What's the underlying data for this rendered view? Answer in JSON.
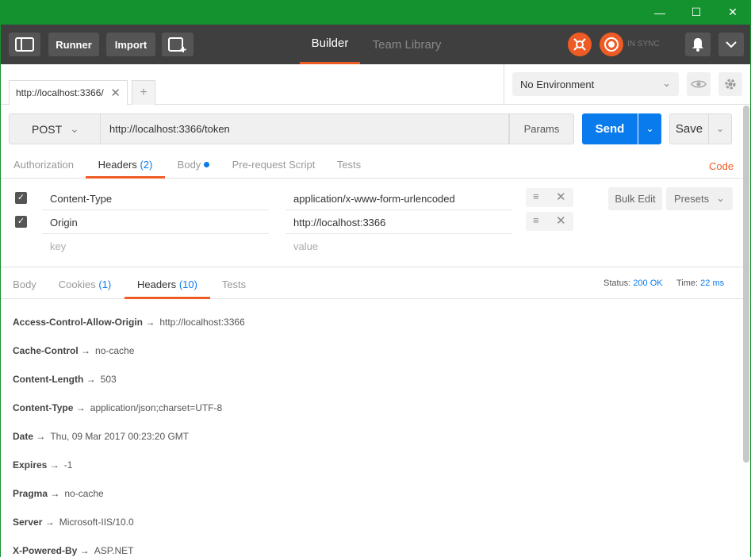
{
  "window": {
    "minimize_glyph": "—",
    "maximize_glyph": "☐",
    "close_glyph": "✕"
  },
  "header": {
    "sidebar_icon": "sidebar-toggle-icon",
    "runner_label": "Runner",
    "import_label": "Import",
    "new_window_icon": "new-window-icon",
    "tabs": [
      {
        "label": "Builder",
        "active": true
      },
      {
        "label": "Team Library",
        "active": false
      }
    ],
    "sync_status": "IN SYNC",
    "accent": "#ef5b25"
  },
  "request_tab": {
    "title": "http://localhost:3366/",
    "close_glyph": "✕",
    "add_glyph": "+"
  },
  "environment": {
    "selected": "No Environment",
    "chevron": "⌄"
  },
  "url_bar": {
    "method": "POST",
    "chevron": "⌄",
    "url": "http://localhost:3366/token",
    "params_label": "Params",
    "send_label": "Send",
    "send_dd_glyph": "⌄",
    "save_label": "Save",
    "save_dd_glyph": "⌄",
    "send_color": "#097bed"
  },
  "request_tabs": {
    "authorization": "Authorization",
    "headers": "Headers",
    "headers_count": "(2)",
    "body": "Body",
    "prerequest": "Pre-request Script",
    "tests": "Tests",
    "code": "Code"
  },
  "headers_editor": {
    "rows": [
      {
        "key": "Content-Type",
        "value": "application/x-www-form-urlencoded",
        "checked": true
      },
      {
        "key": "Origin",
        "value": "http://localhost:3366",
        "checked": true
      }
    ],
    "key_placeholder": "key",
    "value_placeholder": "value",
    "check_glyph": "✓",
    "menu_glyph": "≡",
    "delete_glyph": "✕",
    "bulk_edit_label": "Bulk Edit",
    "presets_label": "Presets",
    "presets_chevron": "⌄"
  },
  "response_tabs": {
    "body": "Body",
    "cookies": "Cookies",
    "cookies_count": "(1)",
    "headers": "Headers",
    "headers_count": "(10)",
    "tests": "Tests"
  },
  "response_status": {
    "status_label": "Status:",
    "status_value": "200 OK",
    "time_label": "Time:",
    "time_value": "22 ms"
  },
  "response_headers": [
    {
      "key": "Access-Control-Allow-Origin →",
      "value": "http://localhost:3366"
    },
    {
      "key": "Cache-Control →",
      "value": "no-cache"
    },
    {
      "key": "Content-Length →",
      "value": "503"
    },
    {
      "key": "Content-Type →",
      "value": "application/json;charset=UTF-8"
    },
    {
      "key": "Date →",
      "value": "Thu, 09 Mar 2017 00:23:20 GMT"
    },
    {
      "key": "Expires →",
      "value": "-1"
    },
    {
      "key": "Pragma →",
      "value": "no-cache"
    },
    {
      "key": "Server →",
      "value": "Microsoft-IIS/10.0"
    },
    {
      "key": "X-Powered-By →",
      "value": "ASP.NET"
    }
  ]
}
